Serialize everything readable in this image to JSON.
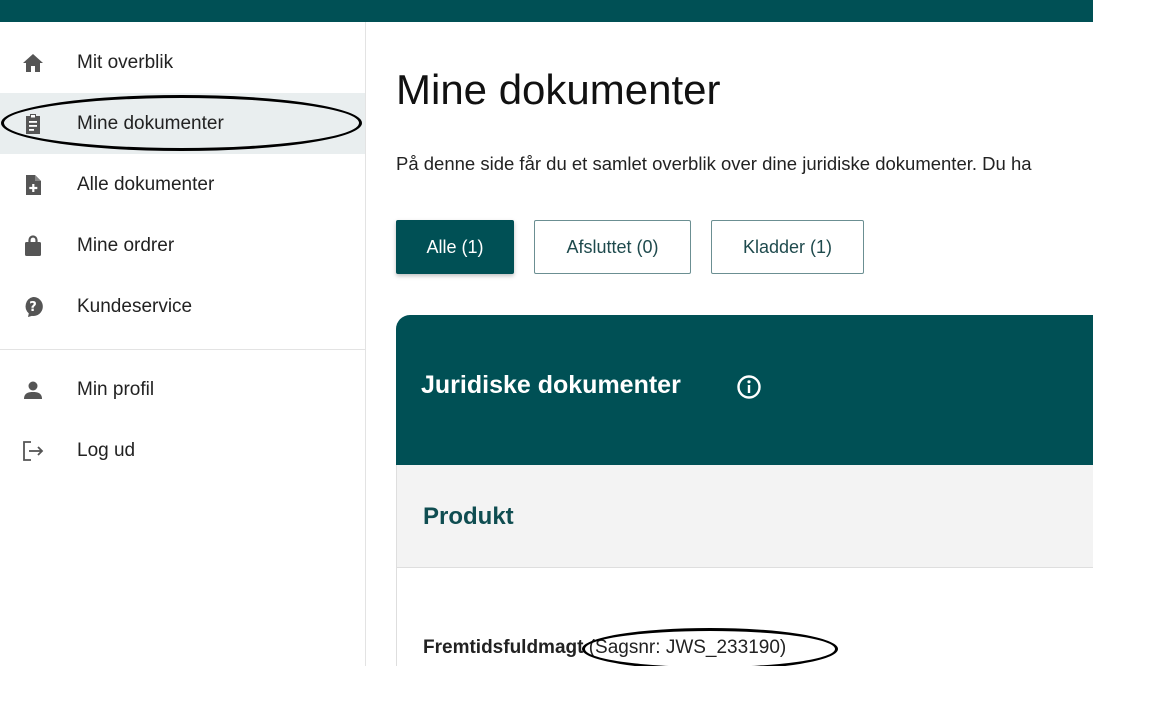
{
  "sidebar": {
    "items": [
      {
        "label": "Mit overblik",
        "icon": "home-icon"
      },
      {
        "label": "Mine dokumenter",
        "icon": "clipboard-icon",
        "active": true
      },
      {
        "label": "Alle dokumenter",
        "icon": "document-add-icon"
      },
      {
        "label": "Mine ordrer",
        "icon": "shopping-bag-icon"
      },
      {
        "label": "Kundeservice",
        "icon": "help-icon"
      },
      {
        "label": "Min profil",
        "icon": "person-icon"
      },
      {
        "label": "Log ud",
        "icon": "logout-icon"
      }
    ]
  },
  "main": {
    "title": "Mine dokumenter",
    "intro": "På denne side får du et samlet overblik over dine juridiske dokumenter. Du ha",
    "filters": [
      {
        "label": "Alle (1)",
        "active": true
      },
      {
        "label": "Afsluttet (0)",
        "active": false
      },
      {
        "label": "Kladder (1)",
        "active": false
      }
    ],
    "card": {
      "title": "Juridiske dokumenter",
      "column_header": "Produkt",
      "document": {
        "name": "Fremtidsfuldmagt",
        "case_number": " (Sagsnr: JWS_233190)"
      }
    }
  },
  "colors": {
    "brand": "#005055",
    "active_nav_bg": "#e9eeef"
  }
}
